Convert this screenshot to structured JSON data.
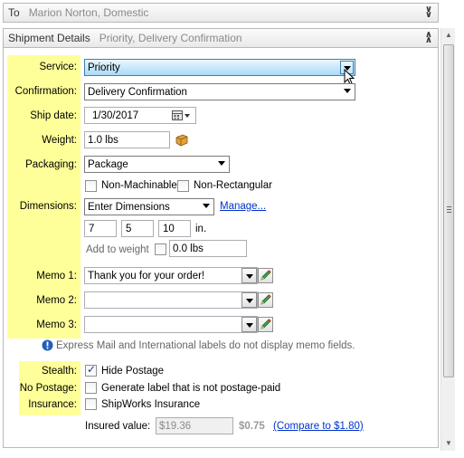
{
  "to_section": {
    "label": "To",
    "summary": "Marion Norton, Domestic",
    "toggle": "expand"
  },
  "shipment_section": {
    "label": "Shipment Details",
    "summary": "Priority, Delivery Confirmation",
    "toggle": "collapse"
  },
  "service": {
    "label": "Service:",
    "value": "Priority"
  },
  "confirmation": {
    "label": "Confirmation:",
    "value": "Delivery Confirmation"
  },
  "ship_date": {
    "label": "Ship date:",
    "value": "1/30/2017"
  },
  "weight": {
    "label": "Weight:",
    "value": "1.0 lbs"
  },
  "packaging": {
    "label": "Packaging:",
    "value": "Package"
  },
  "non_machinable": {
    "label": "Non-Machinable",
    "checked": false
  },
  "non_rectangular": {
    "label": "Non-Rectangular",
    "checked": false
  },
  "dimensions": {
    "label": "Dimensions:",
    "value": "Enter Dimensions",
    "manage_link": "Manage...",
    "length": "7",
    "width": "5",
    "height": "10",
    "unit": "in."
  },
  "add_to_weight": {
    "label": "Add to weight",
    "checked": false,
    "value": "0.0 lbs"
  },
  "memo1": {
    "label": "Memo 1:",
    "value": "Thank you for your order!"
  },
  "memo2": {
    "label": "Memo 2:",
    "value": ""
  },
  "memo3": {
    "label": "Memo 3:",
    "value": ""
  },
  "memo_note": "Express Mail and International labels do not display memo fields.",
  "stealth": {
    "label": "Stealth:",
    "option": "Hide Postage",
    "checked": true
  },
  "no_postage": {
    "label": "No Postage:",
    "option": "Generate label that is not postage-paid",
    "checked": false
  },
  "insurance": {
    "label": "Insurance:",
    "option": "ShipWorks Insurance",
    "checked": false
  },
  "insured_value": {
    "label": "Insured value:",
    "value": "$19.36",
    "cost": "$0.75",
    "compare_link": "(Compare to $1.80)"
  },
  "colors": {
    "highlight": "#ffff99",
    "link": "#0033cc",
    "accent": "#3c7fb1"
  }
}
